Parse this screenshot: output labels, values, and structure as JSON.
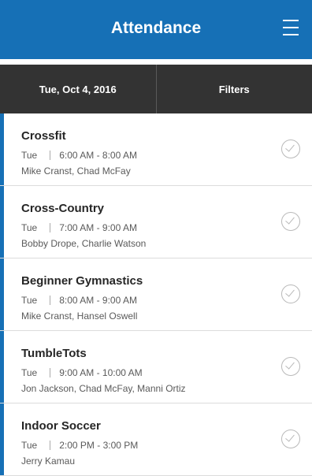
{
  "header": {
    "title": "Attendance",
    "menu_icon": "hamburger-menu-icon"
  },
  "toolbar": {
    "date_label": "Tue, Oct 4, 2016",
    "filters_label": "Filters"
  },
  "colors": {
    "accent": "#1670b6",
    "toolbar_bg": "#333333"
  },
  "classes": [
    {
      "name": "Crossfit",
      "day": "Tue",
      "time": "6:00 AM - 8:00 AM",
      "coaches": "Mike Cranst,  Chad McFay"
    },
    {
      "name": "Cross-Country",
      "day": "Tue",
      "time": "7:00 AM - 9:00 AM",
      "coaches": "Bobby Drope,  Charlie Watson"
    },
    {
      "name": "Beginner Gymnastics",
      "day": "Tue",
      "time": "8:00 AM - 9:00 AM",
      "coaches": "Mike Cranst,  Hansel Oswell"
    },
    {
      "name": "TumbleTots",
      "day": "Tue",
      "time": "9:00 AM - 10:00 AM",
      "coaches": "Jon Jackson,  Chad McFay,  Manni Ortiz"
    },
    {
      "name": "Indoor Soccer",
      "day": "Tue",
      "time": "2:00 PM - 3:00 PM",
      "coaches": "Jerry Kamau"
    }
  ]
}
